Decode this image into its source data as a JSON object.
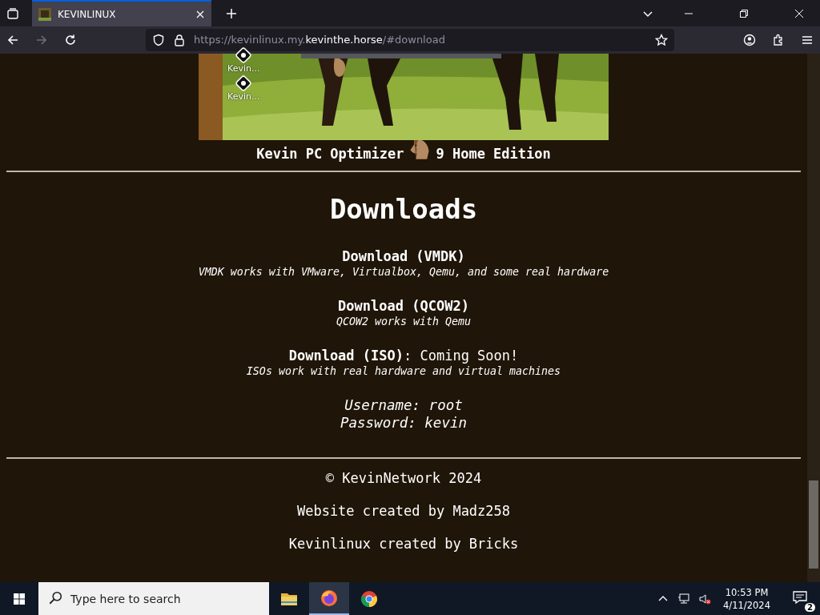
{
  "browser": {
    "tabs": [
      {
        "title": "KEVINLINUX",
        "selected": true
      }
    ],
    "address": {
      "prefix": "https://kevinlinux.my.",
      "domain": "kevinthe.horse",
      "suffix": "/#download"
    },
    "back_disabled": false,
    "forward_disabled": true
  },
  "screenshot": {
    "desktop_icons": [
      {
        "label": "Kevin..."
      },
      {
        "label": "Kevin..."
      }
    ],
    "caption_before": "Kevin PC Optimizer",
    "caption_after": "9 Home Edition"
  },
  "downloads": {
    "title": "Downloads",
    "items": [
      {
        "link": "Download (VMDK)",
        "description": "VMDK works with VMware, Virtualbox, Qemu, and some real hardware"
      },
      {
        "link": "Download (QCOW2)",
        "description": "QCOW2 works with Qemu"
      },
      {
        "link": "Download (ISO)",
        "note": ": Coming Soon!",
        "description": "ISOs work with real hardware and virtual machines"
      }
    ],
    "credentials": [
      "Username: root",
      "Password: kevin"
    ]
  },
  "footer": [
    "© KevinNetwork 2024",
    "Website created by Madz258",
    "Kevinlinux created by Bricks"
  ],
  "taskbar": {
    "search_placeholder": "Type here to search",
    "apps": [
      {
        "kind": "files",
        "selected": false
      },
      {
        "kind": "firefox",
        "selected": true
      },
      {
        "kind": "chrome",
        "selected": false
      }
    ],
    "time": "10:53 PM",
    "date": "4/11/2024",
    "notifications": "2"
  }
}
